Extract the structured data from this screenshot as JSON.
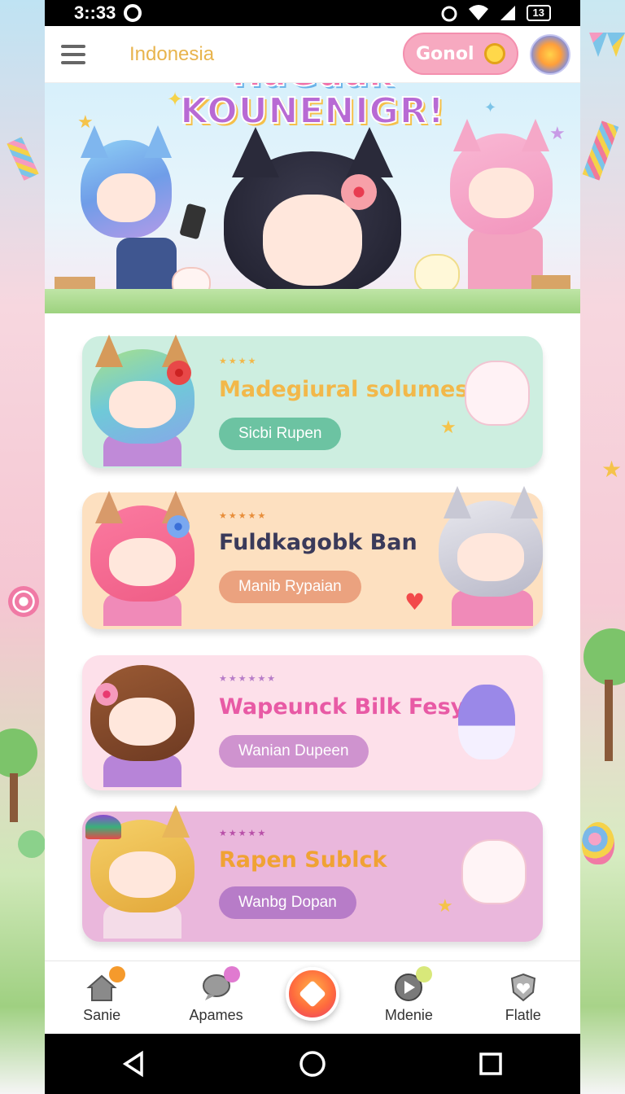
{
  "status": {
    "time": "3::33",
    "battery": "13"
  },
  "appbar": {
    "region": "Indonesia",
    "search_label": "Gonol"
  },
  "banner": {
    "title_line1": "HaGdak",
    "title_line2": "KOUNENIGR!"
  },
  "cards": [
    {
      "stars": "★★★★",
      "title": "Madegiural solumes",
      "cta": "Sicbi Rupen",
      "bg": "#cdeee0",
      "cta_bg": "#6cc3a2",
      "title_color": "#f2b84a"
    },
    {
      "stars": "★★★★★",
      "title": "Fuldkagobk Ban",
      "cta": "Manib Rypaian",
      "bg": "#fde0c0",
      "cta_bg": "#eba27f",
      "title_color": "#3a3a5a"
    },
    {
      "stars": "★★★★★★",
      "title": "Wapeunck Bilk Fesy",
      "cta": "Wanian Dupeen",
      "bg": "#fde0ea",
      "cta_bg": "#cf93cf",
      "title_color": "#e85aa5"
    },
    {
      "stars": "★★★★★",
      "title": "Rapen Sublck",
      "cta": "Wanbg Dopan",
      "bg": "#eab7dc",
      "cta_bg": "#b77cc8",
      "title_color": "#f0a234"
    }
  ],
  "nav": {
    "items": [
      {
        "label": "Sanie",
        "icon": "home-icon",
        "badge_color": "#f59a2c"
      },
      {
        "label": "Apames",
        "icon": "chat-icon",
        "badge_color": "#e07ad0"
      },
      {
        "label": "Mdenie",
        "icon": "play-icon",
        "badge_color": "#d8e87a"
      },
      {
        "label": "Flatle",
        "icon": "shield-heart-icon",
        "badge_color": ""
      }
    ]
  },
  "colors": {
    "accent": "#f7a9c0",
    "statusbar": "#000000"
  }
}
